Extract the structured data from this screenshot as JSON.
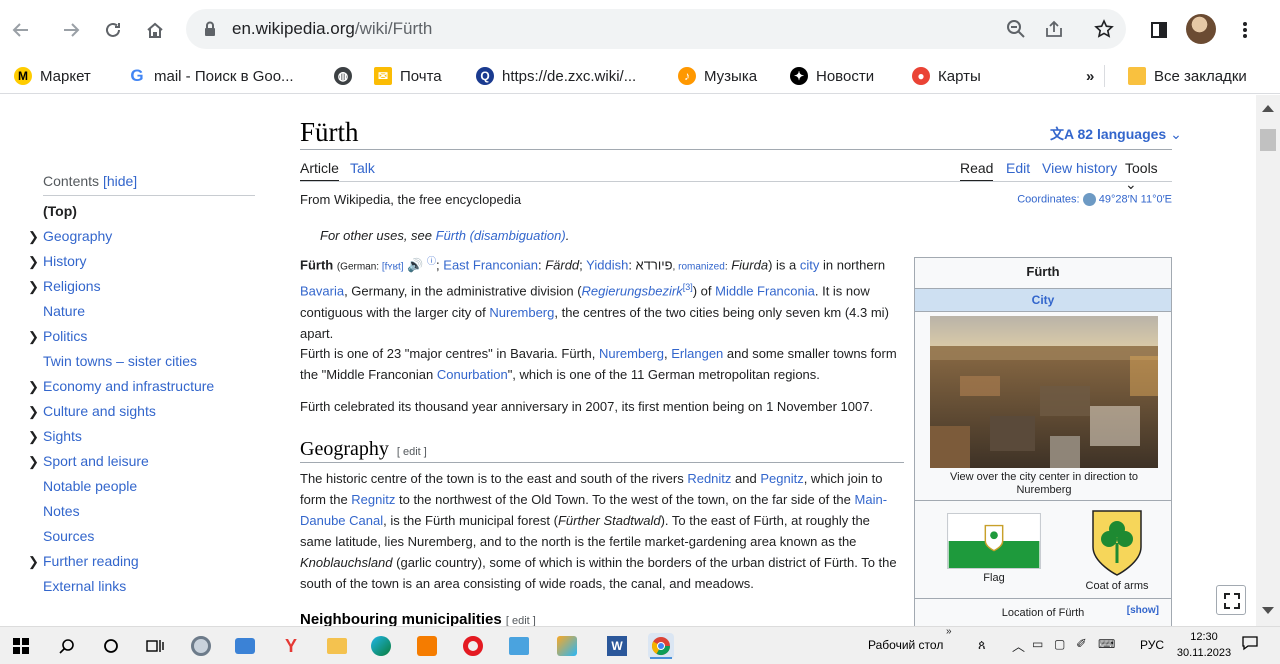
{
  "browser": {
    "url_domain": "en.wikipedia.org",
    "url_path": "/wiki/Fürth"
  },
  "bookmarks": [
    {
      "label": "Маркет",
      "icon": "yandex-market-icon",
      "color": "#fc3f1d"
    },
    {
      "label": "mail - Поиск в Goo...",
      "icon": "google-icon",
      "color": "#4285f4"
    },
    {
      "label": "",
      "icon": "globe-icon",
      "color": "#202124"
    },
    {
      "label": "Почта",
      "icon": "mail-icon",
      "color": "#fbbc04"
    },
    {
      "label": "https://de.zxc.wiki/...",
      "icon": "zxc-wiki-icon",
      "color": "#1a73e8"
    },
    {
      "label": "Музыка",
      "icon": "music-icon",
      "color": "#ff7a00"
    },
    {
      "label": "Новости",
      "icon": "news-icon",
      "color": "#000000"
    },
    {
      "label": "Карты",
      "icon": "maps-pin-icon",
      "color": "#ea4335"
    }
  ],
  "bookmarks_overflow": "»",
  "bookmarks_all": "Все закладки",
  "toc": {
    "header": "Contents",
    "hide": "[hide]",
    "items": [
      {
        "label": "(Top)",
        "expandable": false
      },
      {
        "label": "Geography",
        "expandable": true
      },
      {
        "label": "History",
        "expandable": true
      },
      {
        "label": "Religions",
        "expandable": true
      },
      {
        "label": "Nature",
        "expandable": false
      },
      {
        "label": "Politics",
        "expandable": true
      },
      {
        "label": "Twin towns – sister cities",
        "expandable": false
      },
      {
        "label": "Economy and infrastructure",
        "expandable": true
      },
      {
        "label": "Culture and sights",
        "expandable": true
      },
      {
        "label": "Sights",
        "expandable": true
      },
      {
        "label": "Sport and leisure",
        "expandable": true
      },
      {
        "label": "Notable people",
        "expandable": false
      },
      {
        "label": "Notes",
        "expandable": false
      },
      {
        "label": "Sources",
        "expandable": false
      },
      {
        "label": "Further reading",
        "expandable": true
      },
      {
        "label": "External links",
        "expandable": false
      }
    ]
  },
  "article": {
    "title": "Fürth",
    "languages": "82 languages",
    "tabs_left": [
      "Article",
      "Talk"
    ],
    "tabs_right": [
      "Read",
      "Edit",
      "View history",
      "Tools"
    ],
    "tagline": "From Wikipedia, the free encyclopedia",
    "coords_label": "Coordinates:",
    "coords_value": "49°28′N 11°0′E",
    "hatnote_text": "For other uses, see ",
    "hatnote_link": "Fürth (disambiguation)",
    "hatnote_end": ".",
    "geography_heading": "Geography",
    "edit_label": "[ edit ]",
    "neighbouring_heading": "Neighbouring municipalities",
    "neighbouring_edit": "[ edit ]"
  },
  "infobox": {
    "title": "Fürth",
    "subtitle": "City",
    "caption": "View over the city center in direction to Nuremberg",
    "flag_label": "Flag",
    "coa_label": "Coat of arms",
    "location_label": "Location of Fürth",
    "show_label": "[show]"
  },
  "taskbar": {
    "desktop_label": "Рабочий стол",
    "chevrons": "»",
    "lang": "РУС",
    "time": "12:30",
    "date": "30.11.2023"
  }
}
